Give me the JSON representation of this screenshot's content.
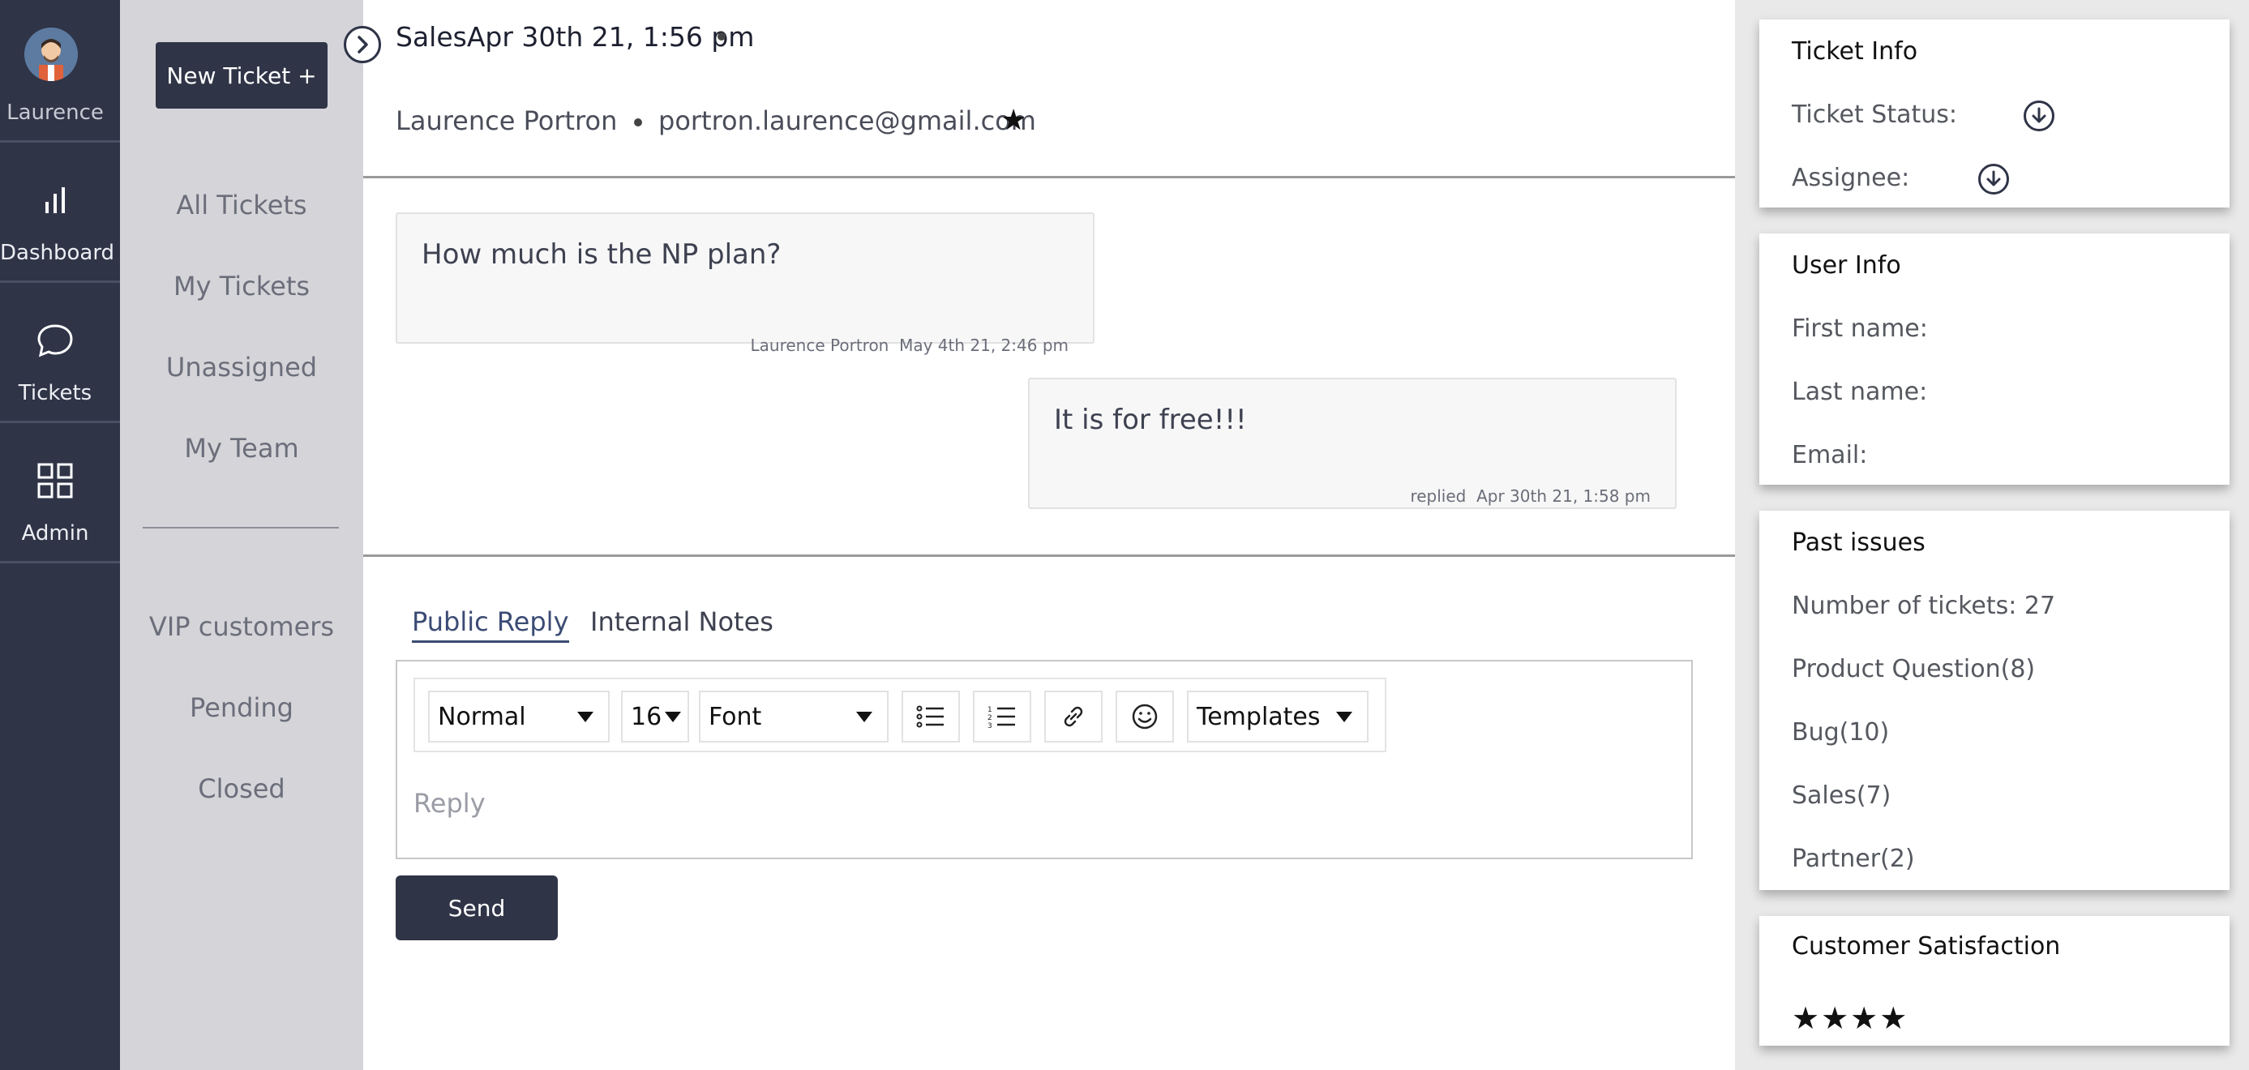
{
  "rail": {
    "user_label": "Laurence",
    "items": [
      {
        "label": "Dashboard",
        "icon": "bar-chart-icon"
      },
      {
        "label": "Tickets",
        "icon": "chat-bubble-icon"
      },
      {
        "label": "Admin",
        "icon": "grid-icon"
      }
    ]
  },
  "subnav": {
    "new_ticket_label": "New Ticket +",
    "links": [
      "All Tickets",
      "My Tickets",
      "Unassigned",
      "My Team"
    ],
    "views": [
      "VIP customers",
      "Pending",
      "Closed"
    ]
  },
  "header": {
    "title": "SalesApr 30th 21, 1:56 pm",
    "name": "Laurence Portron",
    "email": "portron.laurence@gmail.com",
    "star": "★"
  },
  "messages": [
    {
      "text": "How much is the NP plan?",
      "author": "Laurence Portron",
      "time": "May 4th 21, 2:46 pm"
    },
    {
      "text": "It is for free!!!",
      "author": "replied",
      "time": "Apr 30th 21, 1:58 pm"
    }
  ],
  "composer": {
    "tabs": [
      "Public Reply",
      "Internal Notes"
    ],
    "active_tab": "Public Reply",
    "format_value": "Normal",
    "size_value": "16",
    "font_value": "Font",
    "templates_label": "Templates",
    "reply_placeholder": "Reply",
    "send_label": "Send"
  },
  "ticket_info": {
    "title": "Ticket Info",
    "status_label": "Ticket Status:",
    "assignee_label": "Assignee:"
  },
  "user_info": {
    "title": "User Info",
    "first_name_label": "First name:",
    "last_name_label": "Last name:",
    "email_label": "Email:"
  },
  "past_issues": {
    "title": "Past issues",
    "rows": [
      "Number of tickets: 27",
      "Product Question(8)",
      "Bug(10)",
      "Sales(7)",
      "Partner(2)"
    ]
  },
  "satisfaction": {
    "title": "Customer Satisfaction",
    "stars": "★★★★",
    "rating": 4
  },
  "colors": {
    "rail": "#2f3447",
    "subnav": "#d5d4d9",
    "accent": "#3b4b74"
  }
}
